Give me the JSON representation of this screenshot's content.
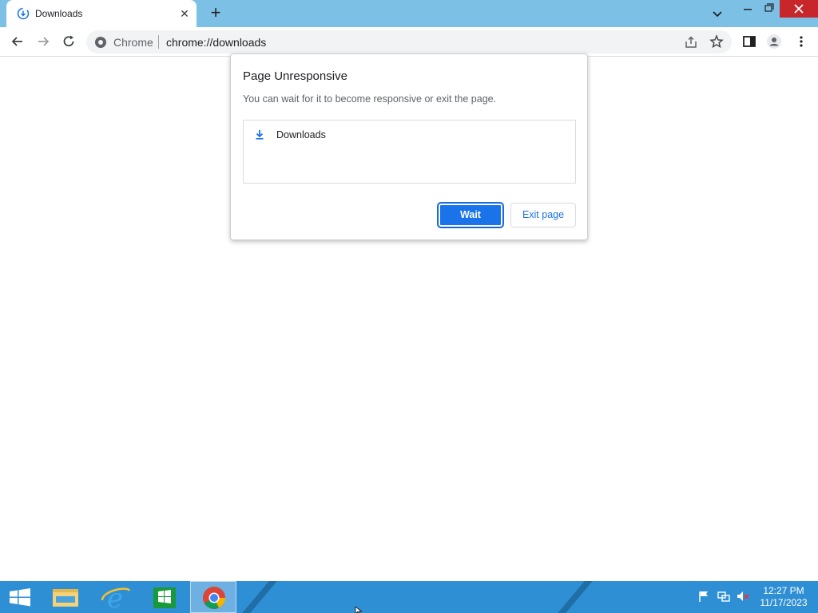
{
  "browser": {
    "tab": {
      "title": "Downloads",
      "close_glyph": "✕"
    },
    "new_tab_glyph": "+",
    "omnibox": {
      "site_chip": "Chrome",
      "url": "chrome://downloads"
    }
  },
  "dialog": {
    "title": "Page Unresponsive",
    "message": "You can wait for it to become responsive or exit the page.",
    "pages": [
      {
        "label": "Downloads",
        "icon": "download-icon"
      }
    ],
    "wait_label": "Wait",
    "exit_label": "Exit page"
  },
  "taskbar": {
    "time": "12:27 PM",
    "date": "11/17/2023",
    "pinned": [
      "windows-start-icon",
      "file-explorer-icon",
      "internet-explorer-icon",
      "store-icon",
      "chrome-icon"
    ]
  },
  "colors": {
    "tabstrip": "#7cc0e6",
    "accent": "#1a73e8",
    "taskbar": "#2f8fd4",
    "close_button": "#c7272a"
  }
}
